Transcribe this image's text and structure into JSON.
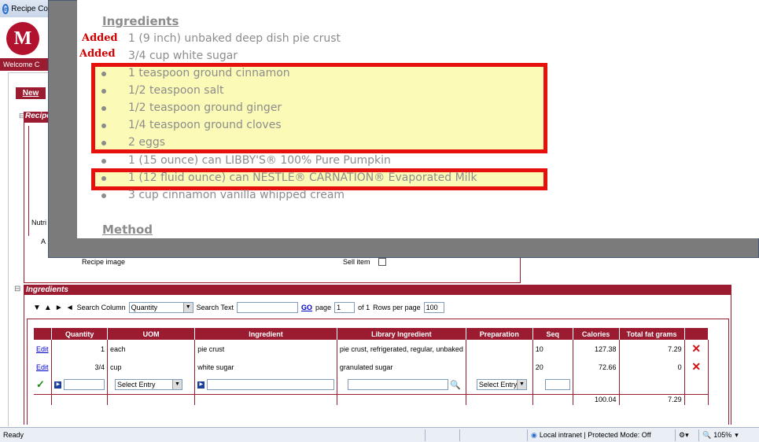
{
  "browser": {
    "tab_title": "Recipe Co",
    "status_ready": "Ready",
    "zone": "Local intranet | Protected Mode: Off",
    "zoom": "105%"
  },
  "app": {
    "logo_glyph": "M",
    "welcome_text": "Welcome C",
    "new_button": "New",
    "recipe_section": "Recipe",
    "nutrition_label": "Nutri",
    "all_label": "A",
    "recipe_image_label": "Recipe image",
    "sell_item_label": "Sell item"
  },
  "overlay": {
    "ingredients_heading": "Ingredients",
    "method_heading": "Method",
    "added_label": "Added",
    "lines": [
      "1 (9 inch) unbaked deep dish pie crust",
      "3/4 cup white sugar",
      "1 teaspoon ground cinnamon",
      "1/2 teaspoon salt",
      "1/2 teaspoon ground ginger",
      "1/4 teaspoon ground cloves",
      "2 eggs",
      "1 (15 ounce) can LIBBY'S® 100% Pure Pumpkin",
      "1 (12 fluid ounce) can NESTLE® CARNATION® Evaporated Milk",
      "3 cup cinnamon vanilla whipped cream"
    ]
  },
  "ingredients_grid": {
    "section_title": "Ingredients",
    "search_column_label": "Search Column",
    "search_column_value": "Quantity",
    "search_text_label": "Search Text",
    "go_label": "GO",
    "page_label": "page",
    "page_value": "1",
    "of_label": "of 1",
    "rows_per_page_label": "Rows per page",
    "rows_per_page_value": "100",
    "columns": [
      "Quantity",
      "UOM",
      "Ingredient",
      "Library Ingredient",
      "Preparation",
      "Seq",
      "Calories",
      "Total fat grams"
    ],
    "rows": [
      {
        "edit": "Edit",
        "quantity": "1",
        "uom": "each",
        "ingredient": "pie crust",
        "library": "pie crust, refrigerated, regular, unbaked",
        "preparation": "",
        "seq": "10",
        "calories": "127.38",
        "fat": "7.29"
      },
      {
        "edit": "Edit",
        "quantity": "3/4",
        "uom": "cup",
        "ingredient": "white sugar",
        "library": "granulated sugar",
        "preparation": "",
        "seq": "20",
        "calories": "72.66",
        "fat": "0"
      }
    ],
    "new_row": {
      "uom_placeholder": "Select Entry",
      "prep_placeholder": "Select Entry"
    },
    "totals": {
      "calories": "100.04",
      "fat": "7.29"
    }
  }
}
